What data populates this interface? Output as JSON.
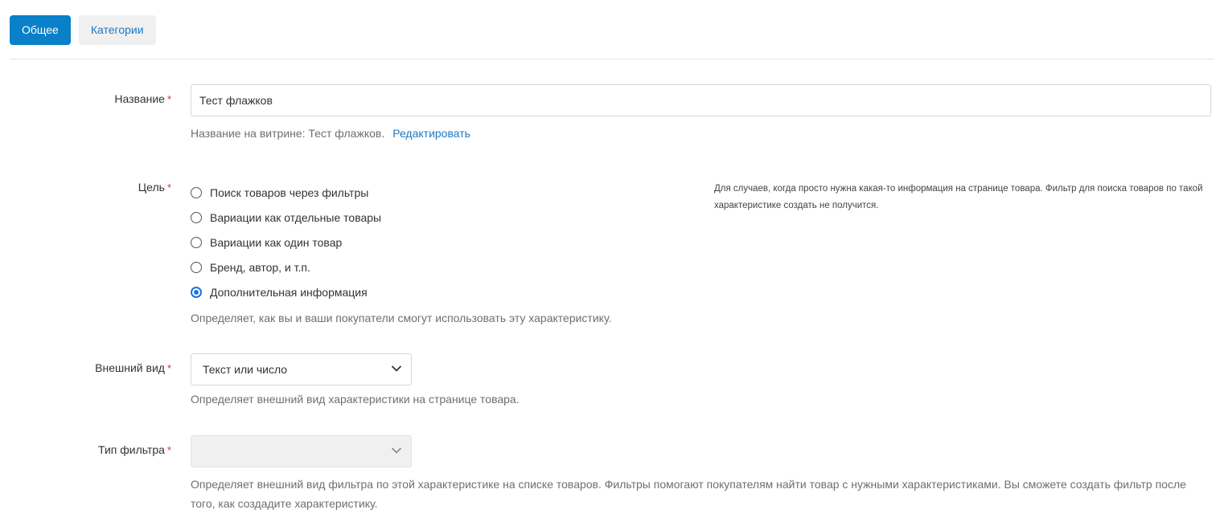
{
  "tabs": [
    {
      "label": "Общее",
      "active": true
    },
    {
      "label": "Категории",
      "active": false
    }
  ],
  "required_mark": "*",
  "name_field": {
    "label": "Название",
    "value": "Тест флажков",
    "storefront_hint": "Название на витрине: Тест флажков.",
    "edit_link": "Редактировать"
  },
  "purpose": {
    "label": "Цель",
    "options": [
      {
        "label": "Поиск товаров через фильтры",
        "checked": false
      },
      {
        "label": "Вариации как отдельные товары",
        "checked": false
      },
      {
        "label": "Вариации как один товар",
        "checked": false
      },
      {
        "label": "Бренд, автор, и т.п.",
        "checked": false
      },
      {
        "label": "Дополнительная информация",
        "checked": true
      }
    ],
    "hint": "Определяет, как вы и ваши покупатели смогут использовать эту характеристику.",
    "side_note": "Для случаев, когда просто нужна какая-то информация на странице товара. Фильтр для поиска товаров по такой характеристике создать не получится."
  },
  "appearance": {
    "label": "Внешний вид",
    "selected": "Текст или число",
    "hint": "Определяет внешний вид характеристики на странице товара."
  },
  "filter_type": {
    "label": "Тип фильтра",
    "selected": "",
    "disabled": true,
    "hint": "Определяет внешний вид фильтра по этой характеристике на списке товаров. Фильтры помогают покупателям найти товар с нужными характеристиками. Вы сможете создать фильтр после того, как создадите характеристику."
  },
  "colors": {
    "accent": "#0a80c9",
    "link": "#1f78c1",
    "required": "#e03131",
    "radio_checked": "#1a73e8"
  }
}
